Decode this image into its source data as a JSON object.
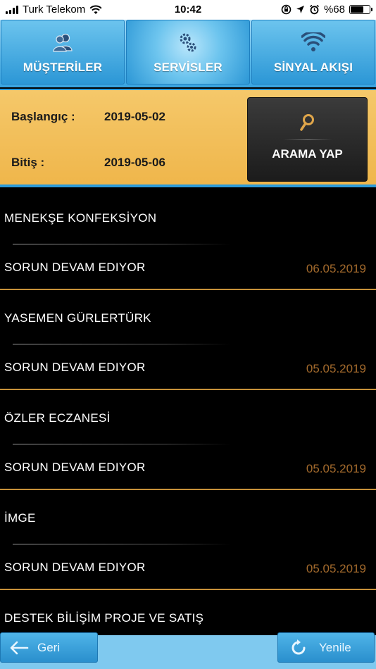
{
  "status_bar": {
    "carrier": "Turk Telekom",
    "time": "10:42",
    "battery": "%68",
    "battery_level": 0.68
  },
  "nav": {
    "tabs": [
      {
        "label": "MÜŞTERİLER",
        "icon": "users-icon"
      },
      {
        "label": "SERVİSLER",
        "icon": "gears-icon",
        "active": true
      },
      {
        "label": "SİNYAL AKIŞI",
        "icon": "wifi-icon"
      }
    ]
  },
  "search": {
    "start_label": "Başlangıç :",
    "start_value": "2019-05-02",
    "end_label": "Bitiş :",
    "end_value": "2019-05-06",
    "button_label": "ARAMA YAP",
    "button_icon": "magnifier-icon"
  },
  "list": {
    "items": [
      {
        "name": "MENEKŞE KONFEKSİYON",
        "status": "SORUN DEVAM EDIYOR",
        "date": "06.05.2019"
      },
      {
        "name": "YASEMEN GÜRLERTÜRK",
        "status": "SORUN DEVAM EDIYOR",
        "date": "05.05.2019"
      },
      {
        "name": "ÖZLER ECZANESİ",
        "status": "SORUN DEVAM EDIYOR",
        "date": "05.05.2019"
      },
      {
        "name": "İMGE",
        "status": "SORUN DEVAM EDIYOR",
        "date": "05.05.2019"
      },
      {
        "name": "DESTEK BİLİŞİM PROJE VE SATIŞ",
        "status": "",
        "date": ""
      }
    ]
  },
  "bottom": {
    "back_label": "Geri",
    "refresh_label": "Yenile"
  },
  "colors": {
    "accent_blue": "#2c97d6",
    "panel_orange": "#efb64b",
    "date_color": "#a36a2c",
    "divider_gold": "#c8923a"
  }
}
